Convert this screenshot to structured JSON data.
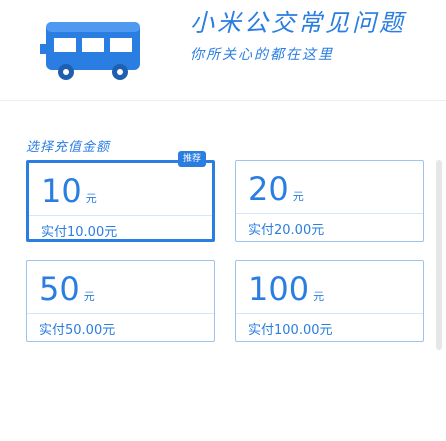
{
  "banner": {
    "title": "小米公交常见问题",
    "subtitle": "你所关心的都在这里"
  },
  "section_label": "选择充值金额",
  "cards": [
    {
      "amount": "10",
      "unit": "元",
      "price": "实付10.00元",
      "badge": "推荐",
      "selected": true
    },
    {
      "amount": "20",
      "unit": "元",
      "price": "实付20.00元",
      "selected": false
    },
    {
      "amount": "50",
      "unit": "元",
      "price": "实付50.00元",
      "selected": false
    },
    {
      "amount": "100",
      "unit": "元",
      "price": "实付100.00元",
      "selected": false
    }
  ],
  "colors": {
    "accent": "#2a7de1",
    "card_border": "#9ec4ee",
    "divider": "#eeeeee"
  },
  "icons": {
    "banner_icon": "bus-icon"
  }
}
